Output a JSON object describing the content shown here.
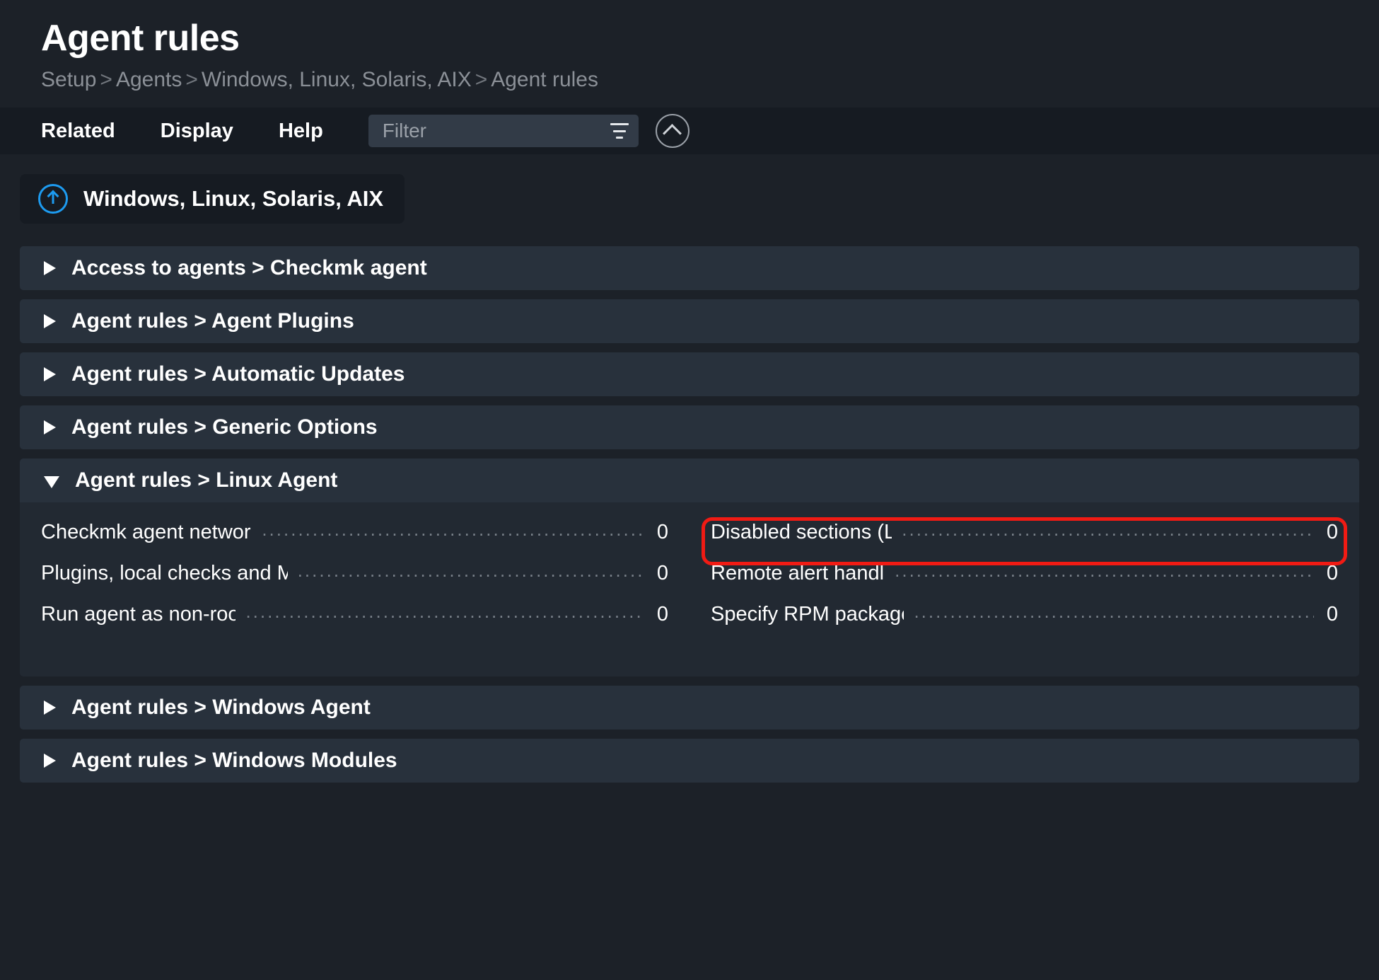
{
  "header": {
    "title": "Agent rules",
    "breadcrumb": [
      "Setup",
      "Agents",
      "Windows, Linux, Solaris, AIX",
      "Agent rules"
    ],
    "breadcrumb_separator": ">"
  },
  "toolbar": {
    "items": [
      "Related",
      "Display",
      "Help"
    ],
    "filter_placeholder": "Filter",
    "filter_value": ""
  },
  "context_button": {
    "label": "Windows, Linux, Solaris, AIX"
  },
  "sections": [
    {
      "title": "Access to agents > Checkmk agent",
      "expanded": false,
      "rules_left": [],
      "rules_right": []
    },
    {
      "title": "Agent rules > Agent Plugins",
      "expanded": false,
      "rules_left": [],
      "rules_right": []
    },
    {
      "title": "Agent rules > Automatic Updates",
      "expanded": false,
      "rules_left": [],
      "rules_right": []
    },
    {
      "title": "Agent rules > Generic Options",
      "expanded": false,
      "rules_left": [],
      "rules_right": []
    },
    {
      "title": "Agent rules > Linux Agent",
      "expanded": true,
      "rules_left": [
        {
          "name": "Checkmk agent network service (Linux)",
          "count": "0",
          "highlighted": false
        },
        {
          "name": "Plugins, local checks and MRPE for non-root users",
          "count": "0",
          "highlighted": false
        },
        {
          "name": "Run agent as non-root user (Linux)",
          "count": "0",
          "highlighted": false
        }
      ],
      "rules_right": [
        {
          "name": "Disabled sections (Linux agent)",
          "count": "0",
          "highlighted": true
        },
        {
          "name": "Remote alert handlers (Linux)",
          "count": "0",
          "highlighted": false
        },
        {
          "name": "Specify RPM package tags (Linux)",
          "count": "0",
          "highlighted": false
        }
      ]
    },
    {
      "title": "Agent rules > Windows Agent",
      "expanded": false,
      "rules_left": [],
      "rules_right": []
    },
    {
      "title": "Agent rules > Windows Modules",
      "expanded": false,
      "rules_left": [],
      "rules_right": []
    }
  ],
  "colors": {
    "page_background": "#1c2128",
    "toolbar_background": "#161b22",
    "section_header_background": "#28313c",
    "section_body_background": "#222932",
    "accent_blue": "#1d9bf0",
    "highlight_red": "#f11b14",
    "muted_text": "#8b9097"
  },
  "icons": {
    "context_button": "arrow-up-circle-icon",
    "filter": "funnel-icon",
    "collapse": "chevron-up-circle-icon",
    "section_collapsed": "triangle-right-icon",
    "section_expanded": "triangle-down-icon"
  }
}
